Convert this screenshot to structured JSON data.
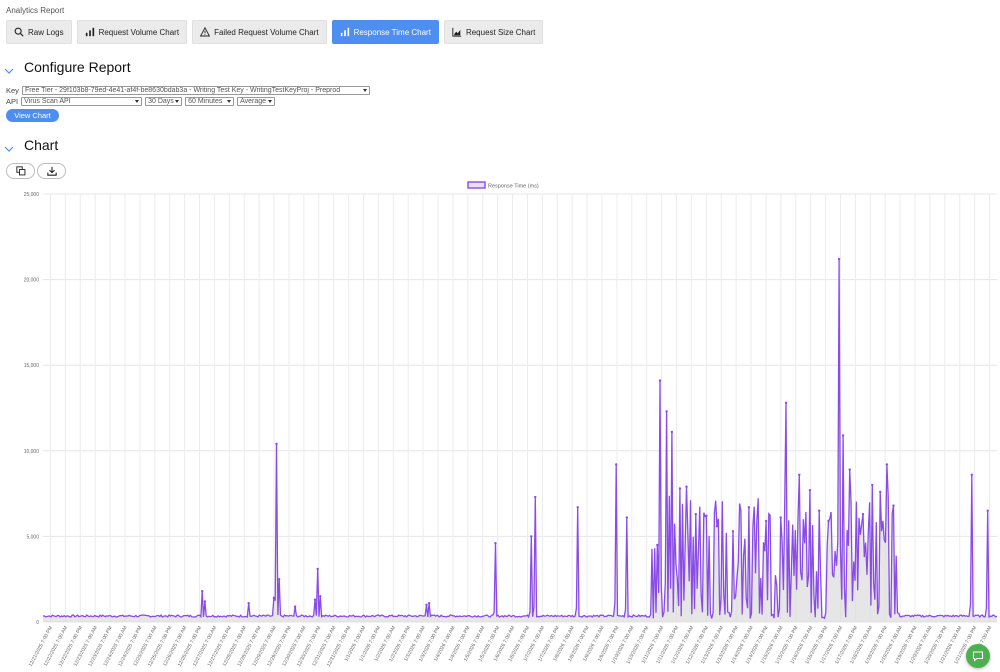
{
  "app": {
    "title": "Analytics Report"
  },
  "tabs": [
    {
      "label": "Raw Logs",
      "icon": "search-icon",
      "active": false
    },
    {
      "label": "Request Volume Chart",
      "icon": "bar-chart-icon",
      "active": false
    },
    {
      "label": "Failed Request Volume Chart",
      "icon": "warning-icon",
      "active": false
    },
    {
      "label": "Response Time Chart",
      "icon": "bar-chart-icon",
      "active": true
    },
    {
      "label": "Request Size Chart",
      "icon": "area-chart-icon",
      "active": false
    }
  ],
  "configure": {
    "title": "Configure Report",
    "key_label": "Key",
    "key_value": "Free Tier - 29f103b8-79ed-4e41-af4f-be8630bdab3a - Writing Test Key - WritingTestKeyProj - Preprod",
    "api_label": "API",
    "api_value": "Virus Scan API",
    "range_value": "30 Days",
    "interval_value": "60 Minutes",
    "agg_value": "Average",
    "view_button": "View Chart"
  },
  "chart_section": {
    "title": "Chart"
  },
  "colors": {
    "accent": "#4d8ef0",
    "series": "#8a4be8",
    "fab": "#4caf50"
  },
  "chart_data": {
    "type": "area",
    "legend": "Response Time (ms)",
    "legend_position": "top",
    "ylim": [
      0,
      25000
    ],
    "yticks": [
      "0",
      "5,000",
      "10,000",
      "15,000",
      "20,000",
      "25,000"
    ],
    "grid": true,
    "n_points": 720,
    "baseline": 350,
    "xlabels": [
      "12/21/2025 7:00 PM",
      "12/22/2025 7:00 AM",
      "12/22/2025 7:00 PM",
      "12/23/2025 7:00 AM",
      "12/23/2025 7:00 PM",
      "12/24/2025 7:00 AM",
      "12/24/2025 7:00 PM",
      "12/25/2025 7:00 AM",
      "12/25/2025 7:00 PM",
      "12/26/2025 7:00 AM",
      "12/26/2025 7:00 PM",
      "12/27/2025 7:00 AM",
      "12/27/2025 7:00 PM",
      "12/28/2025 7:00 AM",
      "12/28/2025 7:00 PM",
      "12/29/2025 7:00 AM",
      "12/29/2025 7:00 PM",
      "12/30/2025 7:00 AM",
      "12/30/2025 7:00 PM",
      "12/31/2025 7:00 AM",
      "12/31/2025 7:00 PM",
      "1/1/2026 7:00 AM",
      "1/1/2026 7:00 PM",
      "1/2/2026 7:00 AM",
      "1/2/2026 7:00 PM",
      "1/3/2026 7:00 AM",
      "1/3/2026 7:00 PM",
      "1/4/2026 7:00 AM",
      "1/4/2026 7:00 PM",
      "1/5/2026 7:00 AM",
      "1/5/2026 7:00 PM",
      "1/6/2026 7:00 AM",
      "1/6/2026 7:00 PM",
      "1/7/2026 7:00 AM",
      "1/7/2026 7:00 PM",
      "1/8/2026 7:00 AM",
      "1/8/2026 7:00 PM",
      "1/9/2026 7:00 AM",
      "1/9/2026 7:00 PM",
      "1/10/2026 7:00 AM",
      "1/10/2026 7:00 PM",
      "1/11/2026 7:00 AM",
      "1/11/2026 7:00 PM",
      "1/12/2026 7:00 AM",
      "1/12/2026 7:00 PM",
      "1/13/2026 7:00 AM",
      "1/13/2026 7:00 PM",
      "1/14/2026 7:00 AM",
      "1/14/2026 7:00 PM",
      "1/15/2026 7:00 AM",
      "1/15/2026 7:00 PM",
      "1/16/2026 7:00 AM",
      "1/16/2026 7:00 PM",
      "1/17/2026 7:00 AM",
      "1/17/2026 7:00 PM",
      "1/18/2026 7:00 AM",
      "1/18/2026 7:00 PM",
      "1/19/2026 7:00 AM",
      "1/19/2026 7:00 PM",
      "1/20/2026 7:00 AM",
      "1/20/2026 7:00 PM",
      "1/21/2026 7:00 AM",
      "1/21/2026 7:00 PM",
      "1/22/2026 7:00 AM"
    ],
    "spikes": [
      {
        "i": 120,
        "v": 1800
      },
      {
        "i": 122,
        "v": 1200
      },
      {
        "i": 155,
        "v": 1100
      },
      {
        "i": 174,
        "v": 1400
      },
      {
        "i": 176,
        "v": 10400
      },
      {
        "i": 178,
        "v": 2500
      },
      {
        "i": 190,
        "v": 900
      },
      {
        "i": 205,
        "v": 1300
      },
      {
        "i": 207,
        "v": 3100
      },
      {
        "i": 209,
        "v": 1500
      },
      {
        "i": 289,
        "v": 1000
      },
      {
        "i": 291,
        "v": 1100
      },
      {
        "i": 341,
        "v": 4600
      },
      {
        "i": 368,
        "v": 5000
      },
      {
        "i": 371,
        "v": 7300
      },
      {
        "i": 403,
        "v": 6700
      },
      {
        "i": 432,
        "v": 9200
      },
      {
        "i": 440,
        "v": 6100
      },
      {
        "i": 463,
        "v": 4500
      },
      {
        "i": 465,
        "v": 14100
      },
      {
        "i": 470,
        "v": 12300
      },
      {
        "i": 474,
        "v": 11100
      },
      {
        "i": 480,
        "v": 7800
      },
      {
        "i": 485,
        "v": 7900
      },
      {
        "i": 492,
        "v": 6300
      },
      {
        "i": 500,
        "v": 6200
      },
      {
        "i": 508,
        "v": 5600
      },
      {
        "i": 520,
        "v": 5300
      },
      {
        "i": 532,
        "v": 6700
      },
      {
        "i": 545,
        "v": 5900
      },
      {
        "i": 556,
        "v": 6100
      },
      {
        "i": 560,
        "v": 12800
      },
      {
        "i": 570,
        "v": 8600
      },
      {
        "i": 578,
        "v": 7700
      },
      {
        "i": 585,
        "v": 6500
      },
      {
        "i": 592,
        "v": 5900
      },
      {
        "i": 600,
        "v": 21200
      },
      {
        "i": 603,
        "v": 10900
      },
      {
        "i": 608,
        "v": 8900
      },
      {
        "i": 618,
        "v": 6300
      },
      {
        "i": 625,
        "v": 8000
      },
      {
        "i": 631,
        "v": 7600
      },
      {
        "i": 636,
        "v": 9200
      },
      {
        "i": 641,
        "v": 6800
      },
      {
        "i": 700,
        "v": 8600
      },
      {
        "i": 712,
        "v": 6500
      }
    ],
    "dense_region": {
      "from": 458,
      "to": 645,
      "max": 7500
    }
  }
}
